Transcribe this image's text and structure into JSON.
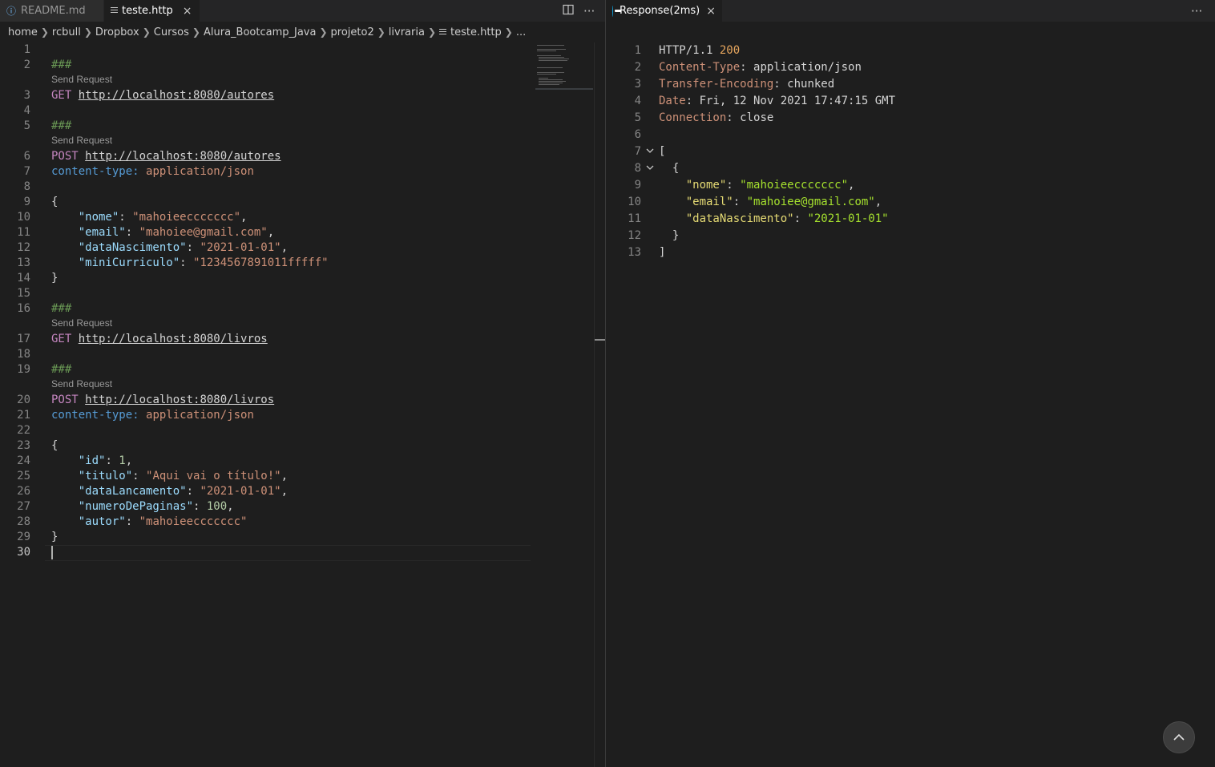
{
  "left_tabs": [
    {
      "label": "README.md",
      "icon": "info-icon",
      "active": false
    },
    {
      "label": "teste.http",
      "icon": "file-lines-icon",
      "active": true,
      "close": "×"
    }
  ],
  "left_actions": {
    "split": "split-editor-icon",
    "more": "···"
  },
  "breadcrumb": [
    "home",
    "rcbull",
    "Dropbox",
    "Cursos",
    "Alura_Bootcamp_Java",
    "projeto2",
    "livraria",
    "teste.http",
    "..."
  ],
  "code_lens": "Send Request",
  "editor": {
    "active_line": 30,
    "lines": [
      {
        "n": "1",
        "parts": []
      },
      {
        "n": "2",
        "parts": [
          [
            "c-comment",
            "###"
          ]
        ]
      },
      {
        "n": "3",
        "lens": true,
        "parts": [
          [
            "c-method",
            "GET"
          ],
          [
            "c-punc",
            " "
          ],
          [
            "c-url",
            "http://localhost:8080/autores"
          ]
        ]
      },
      {
        "n": "4",
        "parts": []
      },
      {
        "n": "5",
        "parts": [
          [
            "c-comment",
            "###"
          ]
        ]
      },
      {
        "n": "6",
        "lens": true,
        "parts": [
          [
            "c-method",
            "POST"
          ],
          [
            "c-punc",
            " "
          ],
          [
            "c-url",
            "http://localhost:8080/autores"
          ]
        ]
      },
      {
        "n": "7",
        "parts": [
          [
            "c-hkey",
            "content-type:"
          ],
          [
            "c-punc",
            " "
          ],
          [
            "c-hval",
            "application/json"
          ]
        ]
      },
      {
        "n": "8",
        "parts": []
      },
      {
        "n": "9",
        "parts": [
          [
            "c-punc",
            "{"
          ]
        ]
      },
      {
        "n": "10",
        "parts": [
          [
            "c-punc",
            "    "
          ],
          [
            "c-key",
            "\"nome\""
          ],
          [
            "c-punc",
            ": "
          ],
          [
            "c-str",
            "\"mahoieeccccccc\""
          ],
          [
            "c-punc",
            ","
          ]
        ]
      },
      {
        "n": "11",
        "parts": [
          [
            "c-punc",
            "    "
          ],
          [
            "c-key",
            "\"email\""
          ],
          [
            "c-punc",
            ": "
          ],
          [
            "c-str",
            "\"mahoiee@gmail.com\""
          ],
          [
            "c-punc",
            ","
          ]
        ]
      },
      {
        "n": "12",
        "parts": [
          [
            "c-punc",
            "    "
          ],
          [
            "c-key",
            "\"dataNascimento\""
          ],
          [
            "c-punc",
            ": "
          ],
          [
            "c-str",
            "\"2021-01-01\""
          ],
          [
            "c-punc",
            ","
          ]
        ]
      },
      {
        "n": "13",
        "parts": [
          [
            "c-punc",
            "    "
          ],
          [
            "c-key",
            "\"miniCurriculo\""
          ],
          [
            "c-punc",
            ": "
          ],
          [
            "c-str",
            "\"1234567891011fffff\""
          ]
        ]
      },
      {
        "n": "14",
        "parts": [
          [
            "c-punc",
            "}"
          ]
        ]
      },
      {
        "n": "15",
        "parts": []
      },
      {
        "n": "16",
        "parts": [
          [
            "c-comment",
            "###"
          ]
        ]
      },
      {
        "n": "17",
        "lens": true,
        "parts": [
          [
            "c-method",
            "GET"
          ],
          [
            "c-punc",
            " "
          ],
          [
            "c-url",
            "http://localhost:8080/livros"
          ]
        ]
      },
      {
        "n": "18",
        "parts": []
      },
      {
        "n": "19",
        "parts": [
          [
            "c-comment",
            "###"
          ]
        ]
      },
      {
        "n": "20",
        "lens": true,
        "parts": [
          [
            "c-method",
            "POST"
          ],
          [
            "c-punc",
            " "
          ],
          [
            "c-url",
            "http://localhost:8080/livros"
          ]
        ]
      },
      {
        "n": "21",
        "parts": [
          [
            "c-hkey",
            "content-type:"
          ],
          [
            "c-punc",
            " "
          ],
          [
            "c-hval",
            "application/json"
          ]
        ]
      },
      {
        "n": "22",
        "parts": []
      },
      {
        "n": "23",
        "parts": [
          [
            "c-punc",
            "{"
          ]
        ]
      },
      {
        "n": "24",
        "parts": [
          [
            "c-punc",
            "    "
          ],
          [
            "c-key",
            "\"id\""
          ],
          [
            "c-punc",
            ": "
          ],
          [
            "c-num",
            "1"
          ],
          [
            "c-punc",
            ","
          ]
        ]
      },
      {
        "n": "25",
        "parts": [
          [
            "c-punc",
            "    "
          ],
          [
            "c-key",
            "\"titulo\""
          ],
          [
            "c-punc",
            ": "
          ],
          [
            "c-str",
            "\"Aqui vai o título!\""
          ],
          [
            "c-punc",
            ","
          ]
        ]
      },
      {
        "n": "26",
        "parts": [
          [
            "c-punc",
            "    "
          ],
          [
            "c-key",
            "\"dataLancamento\""
          ],
          [
            "c-punc",
            ": "
          ],
          [
            "c-str",
            "\"2021-01-01\""
          ],
          [
            "c-punc",
            ","
          ]
        ]
      },
      {
        "n": "27",
        "parts": [
          [
            "c-punc",
            "    "
          ],
          [
            "c-key",
            "\"numeroDePaginas\""
          ],
          [
            "c-punc",
            ": "
          ],
          [
            "c-num",
            "100"
          ],
          [
            "c-punc",
            ","
          ]
        ]
      },
      {
        "n": "28",
        "parts": [
          [
            "c-punc",
            "    "
          ],
          [
            "c-key",
            "\"autor\""
          ],
          [
            "c-punc",
            ": "
          ],
          [
            "c-str",
            "\"mahoieeccccccc\""
          ]
        ]
      },
      {
        "n": "29",
        "parts": [
          [
            "c-punc",
            "}"
          ]
        ]
      },
      {
        "n": "30",
        "parts": []
      }
    ]
  },
  "right_tab": {
    "label": "Response(2ms)",
    "icon": "response-icon",
    "close": "×"
  },
  "right_actions": {
    "more": "···"
  },
  "response": {
    "lines": [
      {
        "n": "1",
        "parts": [
          [
            "r-plain",
            "HTTP/1.1 "
          ],
          [
            "r-status",
            "200"
          ]
        ]
      },
      {
        "n": "2",
        "parts": [
          [
            "r-hname",
            "Content-Type"
          ],
          [
            "r-plain",
            ": application/json"
          ]
        ]
      },
      {
        "n": "3",
        "parts": [
          [
            "r-hname",
            "Transfer-Encoding"
          ],
          [
            "r-plain",
            ": chunked"
          ]
        ]
      },
      {
        "n": "4",
        "parts": [
          [
            "r-hname",
            "Date"
          ],
          [
            "r-plain",
            ": Fri, 12 Nov 2021 17:47:15 GMT"
          ]
        ]
      },
      {
        "n": "5",
        "parts": [
          [
            "r-hname",
            "Connection"
          ],
          [
            "r-plain",
            ": close"
          ]
        ]
      },
      {
        "n": "6",
        "parts": []
      },
      {
        "n": "7",
        "fold": true,
        "parts": [
          [
            "r-plain",
            "["
          ]
        ]
      },
      {
        "n": "8",
        "fold": true,
        "parts": [
          [
            "r-plain",
            "  {"
          ]
        ]
      },
      {
        "n": "9",
        "parts": [
          [
            "r-plain",
            "    "
          ],
          [
            "r-key",
            "\"nome\""
          ],
          [
            "r-plain",
            ": "
          ],
          [
            "r-str",
            "\"mahoieeccccccc\""
          ],
          [
            "r-plain",
            ","
          ]
        ]
      },
      {
        "n": "10",
        "parts": [
          [
            "r-plain",
            "    "
          ],
          [
            "r-key",
            "\"email\""
          ],
          [
            "r-plain",
            ": "
          ],
          [
            "r-str",
            "\"mahoiee@gmail.com\""
          ],
          [
            "r-plain",
            ","
          ]
        ]
      },
      {
        "n": "11",
        "parts": [
          [
            "r-plain",
            "    "
          ],
          [
            "r-key",
            "\"dataNascimento\""
          ],
          [
            "r-plain",
            ": "
          ],
          [
            "r-str",
            "\"2021-01-01\""
          ]
        ]
      },
      {
        "n": "12",
        "parts": [
          [
            "r-plain",
            "  }"
          ]
        ]
      },
      {
        "n": "13",
        "parts": [
          [
            "r-plain",
            "]"
          ]
        ]
      }
    ]
  },
  "scroll_top_icon": "chevron-up-icon",
  "colors": {
    "background": "#1e1e1e",
    "accent": "#0e9fd8"
  }
}
